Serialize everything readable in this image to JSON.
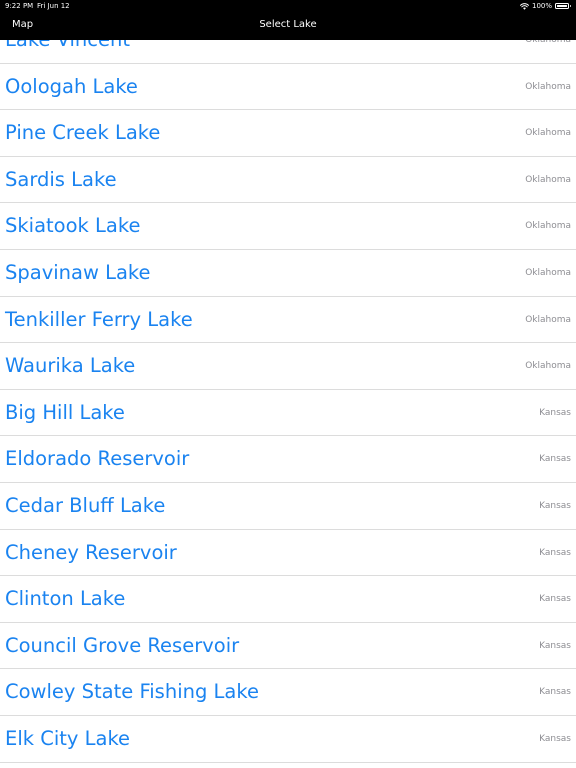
{
  "status_bar": {
    "time": "9:22 PM",
    "date": "Fri Jun 12",
    "battery": "100%"
  },
  "nav": {
    "back_label": "Map",
    "title": "Select Lake"
  },
  "lakes": [
    {
      "name": "Lake Vincent",
      "state": "Oklahoma"
    },
    {
      "name": "Oologah Lake",
      "state": "Oklahoma"
    },
    {
      "name": "Pine Creek Lake",
      "state": "Oklahoma"
    },
    {
      "name": "Sardis Lake",
      "state": "Oklahoma"
    },
    {
      "name": "Skiatook Lake",
      "state": "Oklahoma"
    },
    {
      "name": "Spavinaw Lake",
      "state": "Oklahoma"
    },
    {
      "name": "Tenkiller Ferry Lake",
      "state": "Oklahoma"
    },
    {
      "name": "Waurika Lake",
      "state": "Oklahoma"
    },
    {
      "name": "Big Hill Lake",
      "state": "Kansas"
    },
    {
      "name": "Eldorado Reservoir",
      "state": "Kansas"
    },
    {
      "name": "Cedar Bluff Lake",
      "state": "Kansas"
    },
    {
      "name": "Cheney Reservoir",
      "state": "Kansas"
    },
    {
      "name": "Clinton Lake",
      "state": "Kansas"
    },
    {
      "name": "Council Grove Reservoir",
      "state": "Kansas"
    },
    {
      "name": "Cowley State Fishing Lake",
      "state": "Kansas"
    },
    {
      "name": "Elk City Lake",
      "state": "Kansas"
    }
  ]
}
